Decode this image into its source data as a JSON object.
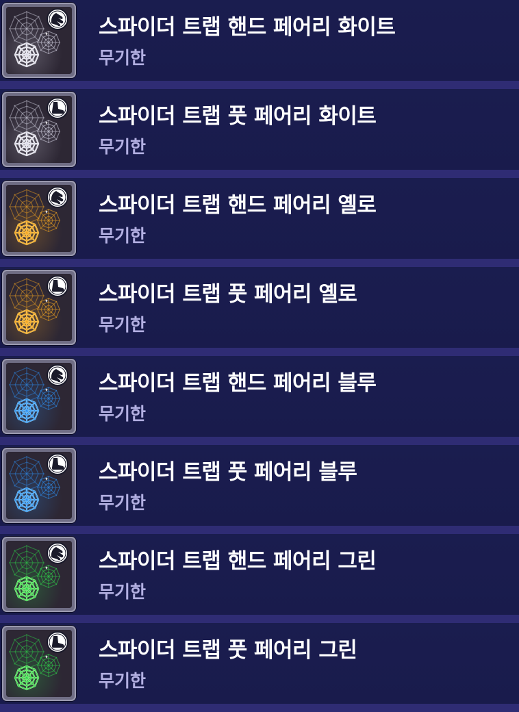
{
  "items": [
    {
      "name": "스파이더 트랩 핸드 페어리 화이트",
      "duration": "무기한",
      "web_color": "#d7d6e6",
      "glow_color": "#ffffff",
      "part_icon": "hand-icon"
    },
    {
      "name": "스파이더 트랩 풋 페어리 화이트",
      "duration": "무기한",
      "web_color": "#d7d6e6",
      "glow_color": "#ffffff",
      "part_icon": "foot-icon"
    },
    {
      "name": "스파이더 트랩 핸드 페어리 옐로",
      "duration": "무기한",
      "web_color": "#f3a521",
      "glow_color": "#ffd36a",
      "part_icon": "hand-icon"
    },
    {
      "name": "스파이더 트랩 풋 페어리 옐로",
      "duration": "무기한",
      "web_color": "#f3a521",
      "glow_color": "#ffd36a",
      "part_icon": "foot-icon"
    },
    {
      "name": "스파이더 트랩 핸드 페어리 블루",
      "duration": "무기한",
      "web_color": "#2e8ff2",
      "glow_color": "#8fd6ff",
      "part_icon": "hand-icon"
    },
    {
      "name": "스파이더 트랩 풋 페어리 블루",
      "duration": "무기한",
      "web_color": "#2e8ff2",
      "glow_color": "#8fd6ff",
      "part_icon": "foot-icon"
    },
    {
      "name": "스파이더 트랩 핸드 페어리 그린",
      "duration": "무기한",
      "web_color": "#2fd54a",
      "glow_color": "#a8ff9a",
      "part_icon": "hand-icon"
    },
    {
      "name": "스파이더 트랩 풋 페어리 그린",
      "duration": "무기한",
      "web_color": "#2fd54a",
      "glow_color": "#a8ff9a",
      "part_icon": "foot-icon"
    }
  ]
}
